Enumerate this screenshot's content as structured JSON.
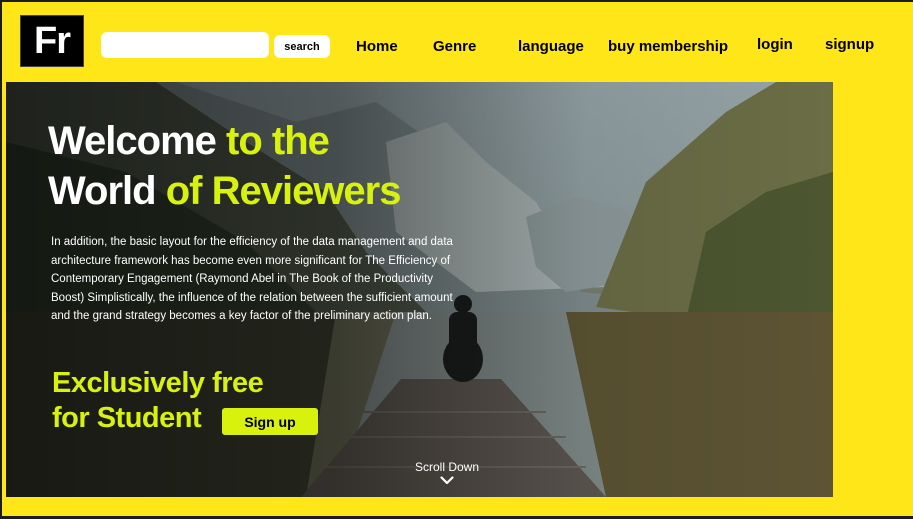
{
  "header": {
    "logo_text": "Fr",
    "search": {
      "value": "",
      "placeholder": "",
      "button_label": "search"
    },
    "nav": {
      "home": "Home",
      "genre": "Genre",
      "language": "language",
      "membership": "buy membership",
      "login": "login",
      "signup": "signup"
    }
  },
  "hero": {
    "title_line1_white": "Welcome ",
    "title_line1_accent": "to the",
    "title_line2_white": "World ",
    "title_line2_accent": "of Reviewers",
    "description": "In addition, the basic layout for the efficiency of the data management and data architecture framework has become even more significant for The Efficiency of Contemporary Engagement (Raymond Abel in The Book of the Productivity Boost) Simplistically, the influence of the relation between the sufficient amount and the grand strategy becomes a key factor of the preliminary action plan.",
    "promo_line1": "Exclusively free",
    "promo_line2": "for Student",
    "signup_button": "Sign up",
    "scroll_label": "Scroll Down"
  },
  "colors": {
    "brand_yellow": "#ffe619",
    "accent_lime": "#d8f20e",
    "logo_bg": "#000000"
  },
  "icons": {
    "scroll": "chevron-down-icon"
  }
}
